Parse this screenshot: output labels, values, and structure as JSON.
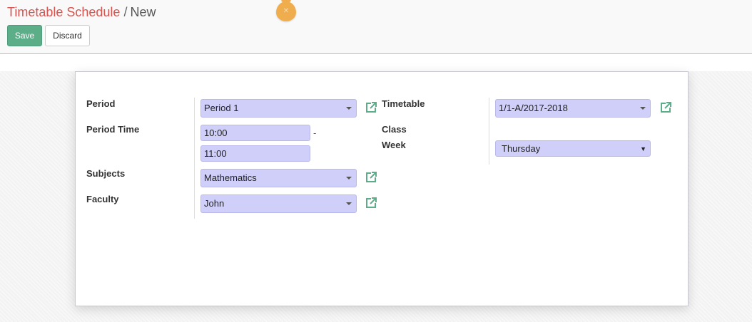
{
  "breadcrumb": {
    "parent": "Timetable Schedule",
    "separator": "/",
    "current": "New"
  },
  "buttons": {
    "save": "Save",
    "discard": "Discard"
  },
  "form": {
    "period": {
      "label": "Period",
      "value": "Period 1"
    },
    "period_time": {
      "label": "Period Time",
      "start": "10:00",
      "separator": "-",
      "end": "11:00"
    },
    "subjects": {
      "label": "Subjects",
      "value": "Mathematics"
    },
    "faculty": {
      "label": "Faculty",
      "value": "John"
    },
    "timetable": {
      "label": "Timetable",
      "value": "1/1-A/2017-2018"
    },
    "class_week": {
      "label_line1": "Class",
      "label_line2": "Week",
      "value": "Thursday"
    }
  },
  "icons": {
    "external_link": "external-link-icon",
    "dropdown": "caret-down-icon",
    "marker": "drop-marker-icon"
  },
  "colors": {
    "brand_link": "#d9534f",
    "save_button": "#5cae88",
    "field_bg": "#cfcffa",
    "external_link": "#5cae88",
    "marker": "#f0ad4e"
  }
}
